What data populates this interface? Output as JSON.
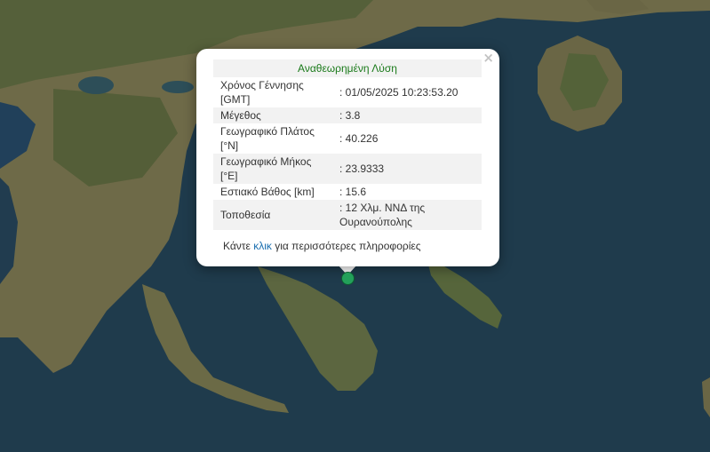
{
  "popup": {
    "title": "Αναθεωρημένη Λύση",
    "close_glyph": "×",
    "rows": [
      {
        "label": "Χρόνος Γέννησης [GMT]",
        "value": ": 01/05/2025 10:23:53.20"
      },
      {
        "label": "Μέγεθος",
        "value": ": 3.8"
      },
      {
        "label": "Γεωγραφικό Πλάτος [°N]",
        "value": ": 40.226"
      },
      {
        "label": "Γεωγραφικό Μήκος [°E]",
        "value": ": 23.9333"
      },
      {
        "label": "Εστιακό Βάθος [km]",
        "value": ": 15.6"
      },
      {
        "label": "Τοποθεσία",
        "value": ": 12 Χλμ. ΝΝΔ της Ουρανούπολης"
      }
    ],
    "more_prefix": "Κάντε ",
    "more_link": "κλικ",
    "more_suffix": " για περισσότερες πληροφορίες"
  },
  "marker": {
    "color": "#23a05a"
  },
  "colors": {
    "sea": "#1f3a4a",
    "land": "#6f6a4a"
  }
}
